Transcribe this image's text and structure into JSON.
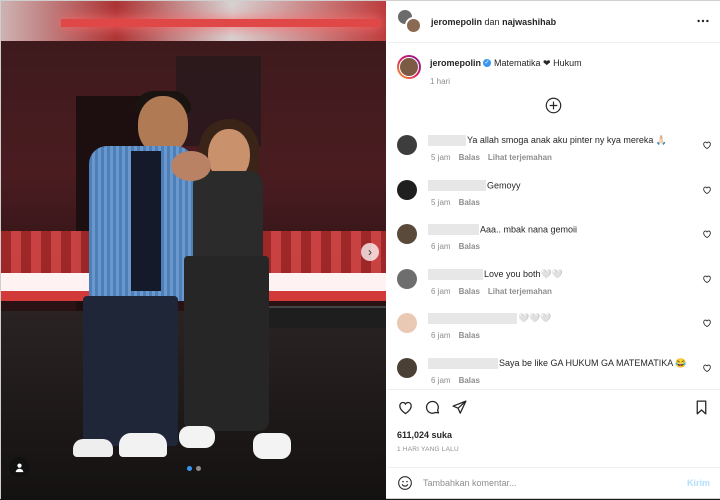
{
  "header": {
    "username": "jeromepolin",
    "separator": "dan",
    "collaborator": "najwashihab"
  },
  "caption": {
    "username": "jeromepolin",
    "text": "Matematika ❤ Hukum",
    "time": "1 hari"
  },
  "comments": [
    {
      "user_width": 38,
      "avatar_color": "#3d3d3d",
      "text": "Ya allah smoga anak aku pinter ny kya mereka 🙏🏻",
      "time": "5 jam",
      "reply": "Balas",
      "translate": "Lihat terjemahan"
    },
    {
      "user_width": 58,
      "avatar_color": "#1f1f1f",
      "text": "Gemoyy",
      "time": "5 jam",
      "reply": "Balas",
      "translate": ""
    },
    {
      "user_width": 51,
      "avatar_color": "#5a4a3c",
      "text": "Aaa.. mbak nana gemoii",
      "time": "6 jam",
      "reply": "Balas",
      "translate": ""
    },
    {
      "user_width": 55,
      "avatar_color": "#6e6e6e",
      "text": "Love you both🤍🤍",
      "time": "6 jam",
      "reply": "Balas",
      "translate": "Lihat terjemahan"
    },
    {
      "user_width": 89,
      "avatar_color": "#e9c9b4",
      "text": "🤍🤍🤍",
      "time": "6 jam",
      "reply": "Balas",
      "translate": ""
    },
    {
      "user_width": 70,
      "avatar_color": "#4a4036",
      "text": "Saya be like GA HUKUM GA MATEMATIKA 😂",
      "time": "6 jam",
      "reply": "Balas",
      "translate": ""
    }
  ],
  "likes": "611,024 suka",
  "date": "1 HARI YANG LALU",
  "add_comment": {
    "placeholder": "Tambahkan komentar...",
    "post_label": "Kirim"
  },
  "icons": {
    "more": "more-icon",
    "load_more": "plus-circle-icon",
    "like": "heart-icon",
    "comment": "comment-icon",
    "share": "share-icon",
    "save": "bookmark-icon",
    "emoji": "emoji-icon",
    "next": "chevron-right-icon",
    "tag": "user-tag-icon"
  },
  "carousel": {
    "count": 2,
    "active": 1
  }
}
